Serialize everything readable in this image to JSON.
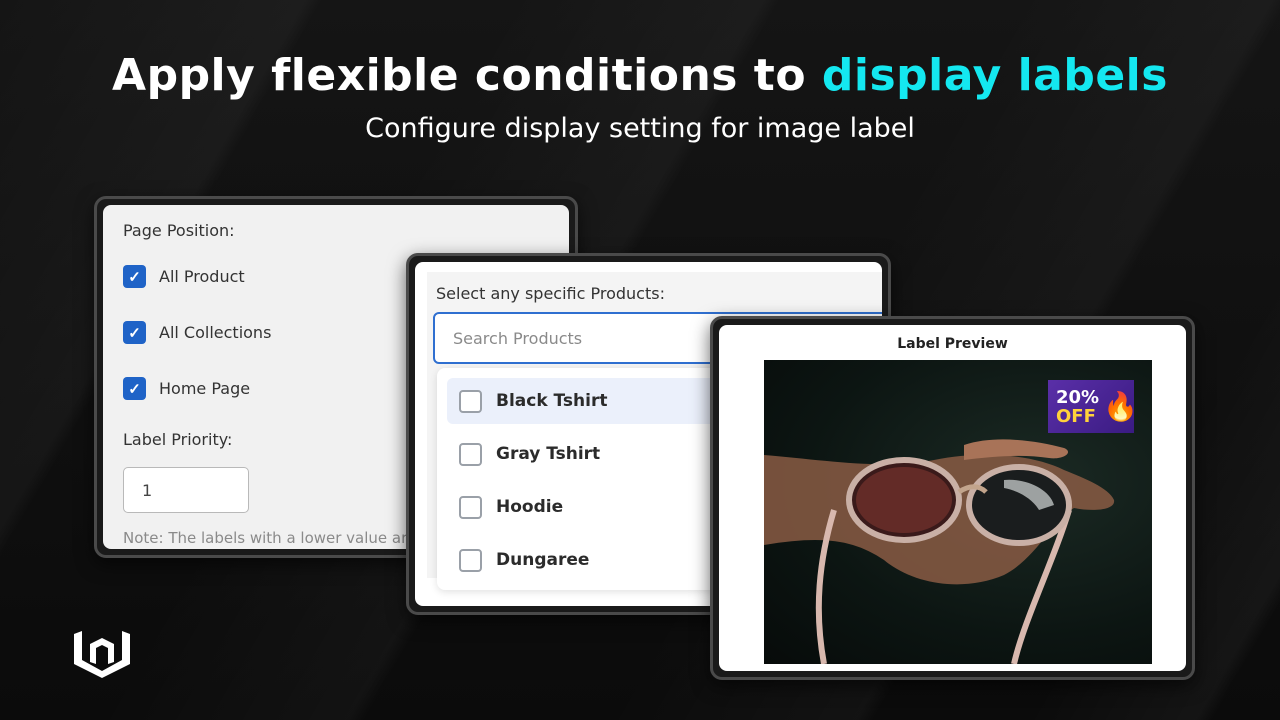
{
  "hero": {
    "title_main": "Apply flexible conditions to ",
    "title_accent": "display labels",
    "subtitle": "Configure display setting for image label",
    "accent_color": "#14e8f0"
  },
  "panel_page_position": {
    "heading": "Page Position:",
    "options": [
      {
        "label": "All Product",
        "checked": true
      },
      {
        "label": "All Collections",
        "checked": true
      },
      {
        "label": "Home Page",
        "checked": true
      }
    ],
    "priority_label": "Label Priority:",
    "priority_value": "1",
    "note": "Note: The labels with a lower value ar"
  },
  "panel_products": {
    "heading": "Select any specific Products:",
    "search_placeholder": "Search Products",
    "items": [
      {
        "label": "Black Tshirt",
        "checked": false
      },
      {
        "label": "Gray Tshirt",
        "checked": false
      },
      {
        "label": "Hoodie",
        "checked": false
      },
      {
        "label": "Dungaree",
        "checked": false
      }
    ]
  },
  "panel_preview": {
    "title": "Label Preview",
    "badge": {
      "percent": "20%",
      "off": "OFF",
      "icon": "fire-icon"
    },
    "image_subject": "hand holding sunglasses"
  },
  "brand": {
    "logo_icon": "brand-logo-icon",
    "checkbox_color": "#1f63c7"
  }
}
